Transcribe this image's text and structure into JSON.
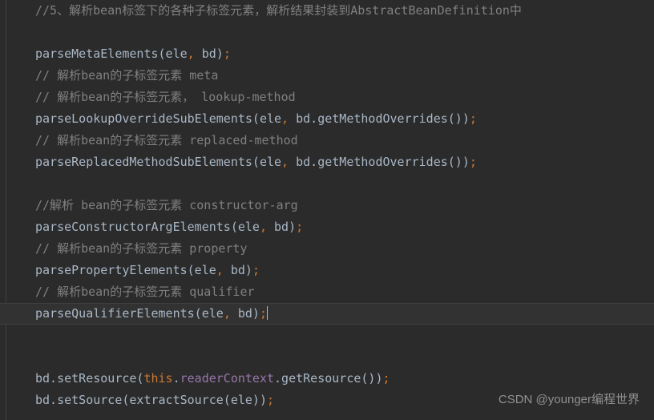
{
  "editor": {
    "theme_name": "darcula",
    "background_color": "#2b2b2b",
    "current_line_color": "#323232",
    "colors": {
      "plain": "#a9b7c6",
      "comment": "#808080",
      "punctuation": "#cc7832",
      "keyword": "#cc7832",
      "field": "#9876aa",
      "caret": "#bbbbbb"
    },
    "lines": [
      {
        "id": "line-1",
        "current": false,
        "tokens": [
          {
            "text": "//5、解析bean标签下的各种子标签元素，解析结果封装到AbstractBeanDefinition中",
            "cls": "tok-comment"
          }
        ]
      },
      {
        "id": "line-2",
        "current": false,
        "tokens": [
          {
            "text": "",
            "cls": "tok-plain"
          }
        ]
      },
      {
        "id": "line-3",
        "current": false,
        "tokens": [
          {
            "text": "parseMetaElements(ele",
            "cls": "tok-plain"
          },
          {
            "text": ",",
            "cls": "tok-punct"
          },
          {
            "text": " bd)",
            "cls": "tok-plain"
          },
          {
            "text": ";",
            "cls": "tok-punct"
          }
        ]
      },
      {
        "id": "line-4",
        "current": false,
        "tokens": [
          {
            "text": "// 解析bean的子标签元素 meta",
            "cls": "tok-comment"
          }
        ]
      },
      {
        "id": "line-5",
        "current": false,
        "tokens": [
          {
            "text": "// 解析bean的子标签元素， lookup-method",
            "cls": "tok-comment"
          }
        ]
      },
      {
        "id": "line-6",
        "current": false,
        "tokens": [
          {
            "text": "parseLookupOverrideSubElements(ele",
            "cls": "tok-plain"
          },
          {
            "text": ",",
            "cls": "tok-punct"
          },
          {
            "text": " bd.getMethodOverrides())",
            "cls": "tok-plain"
          },
          {
            "text": ";",
            "cls": "tok-punct"
          }
        ]
      },
      {
        "id": "line-7",
        "current": false,
        "tokens": [
          {
            "text": "// 解析bean的子标签元素 replaced-method",
            "cls": "tok-comment"
          }
        ]
      },
      {
        "id": "line-8",
        "current": false,
        "tokens": [
          {
            "text": "parseReplacedMethodSubElements(ele",
            "cls": "tok-plain"
          },
          {
            "text": ",",
            "cls": "tok-punct"
          },
          {
            "text": " bd.getMethodOverrides())",
            "cls": "tok-plain"
          },
          {
            "text": ";",
            "cls": "tok-punct"
          }
        ]
      },
      {
        "id": "line-9",
        "current": false,
        "tokens": [
          {
            "text": "",
            "cls": "tok-plain"
          }
        ]
      },
      {
        "id": "line-10",
        "current": false,
        "tokens": [
          {
            "text": "//解析 bean的子标签元素 constructor-arg",
            "cls": "tok-comment"
          }
        ]
      },
      {
        "id": "line-11",
        "current": false,
        "tokens": [
          {
            "text": "parseConstructorArgElements(ele",
            "cls": "tok-plain"
          },
          {
            "text": ",",
            "cls": "tok-punct"
          },
          {
            "text": " bd)",
            "cls": "tok-plain"
          },
          {
            "text": ";",
            "cls": "tok-punct"
          }
        ]
      },
      {
        "id": "line-12",
        "current": false,
        "tokens": [
          {
            "text": "// 解析bean的子标签元素 property",
            "cls": "tok-comment"
          }
        ]
      },
      {
        "id": "line-13",
        "current": false,
        "tokens": [
          {
            "text": "parsePropertyElements(ele",
            "cls": "tok-plain"
          },
          {
            "text": ",",
            "cls": "tok-punct"
          },
          {
            "text": " bd)",
            "cls": "tok-plain"
          },
          {
            "text": ";",
            "cls": "tok-punct"
          }
        ]
      },
      {
        "id": "line-14",
        "current": false,
        "tokens": [
          {
            "text": "// 解析bean的子标签元素 qualifier",
            "cls": "tok-comment"
          }
        ]
      },
      {
        "id": "line-15",
        "current": true,
        "caret": true,
        "tokens": [
          {
            "text": "parseQualifierElements(ele",
            "cls": "tok-plain"
          },
          {
            "text": ",",
            "cls": "tok-punct"
          },
          {
            "text": " bd)",
            "cls": "tok-plain"
          },
          {
            "text": ";",
            "cls": "tok-punct"
          }
        ]
      },
      {
        "id": "line-16",
        "current": false,
        "tokens": [
          {
            "text": "",
            "cls": "tok-plain"
          }
        ]
      },
      {
        "id": "line-17",
        "current": false,
        "tokens": [
          {
            "text": "",
            "cls": "tok-plain"
          }
        ]
      },
      {
        "id": "line-18",
        "current": false,
        "tokens": [
          {
            "text": "bd.setResource(",
            "cls": "tok-plain"
          },
          {
            "text": "this",
            "cls": "tok-keyword"
          },
          {
            "text": ".",
            "cls": "tok-plain"
          },
          {
            "text": "readerContext",
            "cls": "tok-field"
          },
          {
            "text": ".getResource())",
            "cls": "tok-plain"
          },
          {
            "text": ";",
            "cls": "tok-punct"
          }
        ]
      },
      {
        "id": "line-19",
        "current": false,
        "tokens": [
          {
            "text": "bd.setSource(extractSource(ele))",
            "cls": "tok-plain"
          },
          {
            "text": ";",
            "cls": "tok-punct"
          }
        ]
      }
    ]
  },
  "watermark": {
    "text": "CSDN @younger编程世界"
  }
}
